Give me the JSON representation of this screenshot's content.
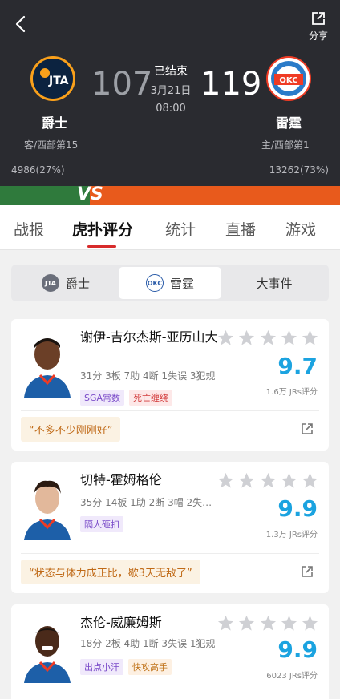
{
  "header": {
    "share_label": "分享",
    "away": {
      "name": "爵士",
      "rank": "客/西部第15",
      "score": "107",
      "support": "4986(27%)",
      "logo_text": "JTA"
    },
    "home": {
      "name": "雷霆",
      "rank": "主/西部第1",
      "score": "119",
      "support": "13262(73%)",
      "logo_text": "OKC"
    },
    "status": "已结束",
    "date": "3月21日",
    "time": "08:00",
    "vs_text": "VS",
    "colors": {
      "away": "#2f7a3c",
      "home": "#e85a1c",
      "background": "#2a2b30"
    }
  },
  "tabs": [
    "战报",
    "虎扑评分",
    "统计",
    "直播",
    "游戏"
  ],
  "active_tab": "虎扑评分",
  "subtabs": [
    {
      "label": "爵士",
      "logo": "JTA"
    },
    {
      "label": "雷霆",
      "logo": "OKC"
    },
    {
      "label": "大事件"
    }
  ],
  "players": [
    {
      "name": "谢伊-吉尔杰斯-亚历山大",
      "stats": "31分 3板 7助 4断 1失误 3犯规",
      "rating": "9.7",
      "rating_count": "1.6万 JRs评分",
      "tags": [
        {
          "text": "SGA常数",
          "style": "purple"
        },
        {
          "text": "死亡缠绕",
          "style": "red"
        }
      ],
      "quote": "“不多不少刚刚好”",
      "stars": 0
    },
    {
      "name": "切特-霍姆格伦",
      "stats": "35分 14板 1助 2断 3帽 2失…",
      "rating": "9.9",
      "rating_count": "1.3万 JRs评分",
      "tags": [
        {
          "text": "隔人砸扣",
          "style": "purple"
        }
      ],
      "quote": "“状态与体力成正比，歇3天无敌了”",
      "stars": 0
    },
    {
      "name": "杰伦-威廉姆斯",
      "stats": "18分 2板 4助 1断 3失误 1犯规",
      "rating": "9.9",
      "rating_count": "6023 JRs评分",
      "tags": [
        {
          "text": "出点小汗",
          "style": "purple"
        },
        {
          "text": "快攻高手",
          "style": "orange"
        }
      ],
      "stars": 0
    }
  ]
}
